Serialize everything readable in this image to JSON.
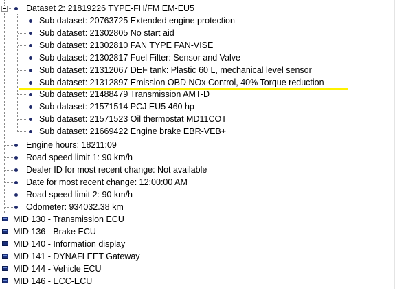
{
  "tree": {
    "dataset": {
      "label": "Dataset 2:  21819226 TYPE-FH/FM EM-EU5",
      "expanded": true
    },
    "sub_datasets": [
      "Sub dataset:  20763725 Extended engine protection",
      "Sub dataset:  21302805 No start aid",
      "Sub dataset:  21302810 FAN TYPE FAN-VISE",
      "Sub dataset:  21302817 Fuel Filter: Sensor and Valve",
      "Sub dataset:  21312067 DEF tank: Plastic 60 L, mechanical level sensor",
      "Sub dataset:  21312897 Emission OBD NOx Control, 40% Torque reduction",
      "Sub dataset:  21488479 Transmission AMT-D",
      "Sub dataset:  21571514 PCJ EU5 460 hp",
      "Sub dataset:  21571523 Oil thermostat MD11COT",
      "Sub dataset:  21669422 Engine brake EBR-VEB+"
    ],
    "properties": [
      "Engine hours:  18211:09",
      "Road speed limit 1:  90 km/h",
      "Dealer ID for most recent change:  Not available",
      "Date for most recent change:  12:00:00 AM",
      "Road speed limit 2:  90 km/h",
      "Odometer:  934032.38 km"
    ],
    "ecus": [
      "MID 130 - Transmission ECU",
      "MID 136 - Brake ECU",
      "MID 140 - Information display",
      "MID 141 - DYNAFLEET Gateway",
      "MID 144 - Vehicle ECU",
      "MID 146 - ECC-ECU"
    ]
  },
  "colors": {
    "highlight": "#fff200",
    "ecu_icon": "#1b2f7a",
    "bullet": "#1f2a6b"
  }
}
